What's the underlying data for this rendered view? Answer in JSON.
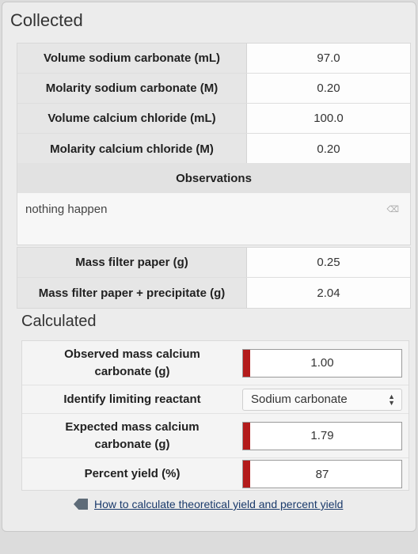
{
  "collected": {
    "title": "Collected",
    "rows": [
      {
        "label": "Volume sodium carbonate (mL)",
        "value": "97.0"
      },
      {
        "label": "Molarity sodium carbonate (M)",
        "value": "0.20"
      },
      {
        "label": "Volume calcium chloride (mL)",
        "value": "100.0"
      },
      {
        "label": "Molarity calcium chloride (M)",
        "value": "0.20"
      }
    ],
    "observations_label": "Observations",
    "observations_text": "nothing happen",
    "mass_rows": [
      {
        "label": "Mass filter paper (g)",
        "value": "0.25"
      },
      {
        "label": "Mass filter paper + precipitate (g)",
        "value": "2.04"
      }
    ]
  },
  "calculated": {
    "title": "Calculated",
    "observed_label": "Observed mass calcium carbonate (g)",
    "observed_value": "1.00",
    "limiting_label": "Identify limiting reactant",
    "limiting_value": "Sodium carbonate",
    "expected_label": "Expected mass calcium carbonate (g)",
    "expected_value": "1.79",
    "percent_label": "Percent yield (%)",
    "percent_value": "87"
  },
  "help_link": "How to calculate theoretical yield and percent yield"
}
